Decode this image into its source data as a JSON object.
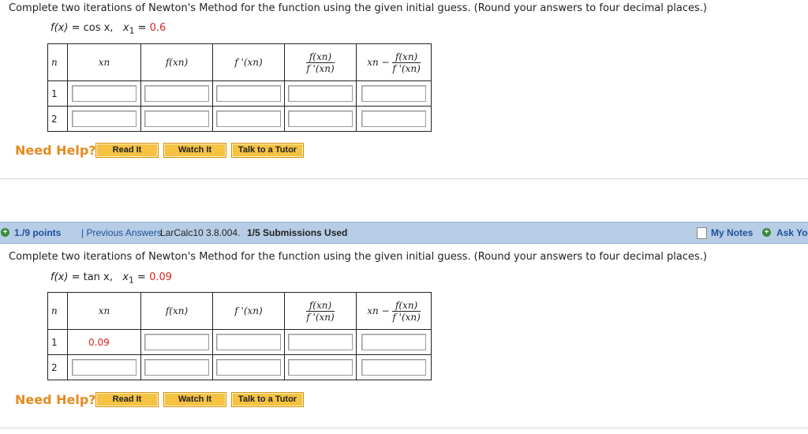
{
  "q1": {
    "instruction": "Complete two iterations of Newton's Method for the function using the given initial guess. (Round your answers to four decimal places.)",
    "f_label": "f(x)",
    "equals": "=",
    "func": "cos x,",
    "x1_label": "x",
    "x1_sub": "1",
    "x1_value": "0.6",
    "rows": [
      {
        "n": "1",
        "given": ""
      },
      {
        "n": "2",
        "given": ""
      }
    ]
  },
  "q2": {
    "instruction": "Complete two iterations of Newton's Method for the function using the given initial guess. (Round your answers to four decimal places.)",
    "f_label": "f(x)",
    "equals": "=",
    "func": "tan x,",
    "x1_label": "x",
    "x1_sub": "1",
    "x1_value": "0.09",
    "rows": [
      {
        "n": "1",
        "given": "0.09"
      },
      {
        "n": "2",
        "given": ""
      }
    ]
  },
  "table_headers": {
    "n": "n",
    "xn": "xn",
    "fxn": "f(xn)",
    "fpxn": "f '(xn)",
    "ratio_num": "f(xn)",
    "ratio_den": "f '(xn)",
    "update_prefix": "xn −",
    "update_num": "f(xn)",
    "update_den": "f '(xn)"
  },
  "help": {
    "label": "Need Help?",
    "read": "Read It",
    "watch": "Watch It",
    "talk": "Talk to a Tutor"
  },
  "bar": {
    "points": "1./9 points",
    "previous": "| Previous Answers",
    "source": "LarCalc10 3.8.004.",
    "submissions": "1/5 Submissions Used",
    "notes": "My Notes",
    "ask": "Ask Yo"
  },
  "colors": {
    "accent_orange": "#e68a1e",
    "bar_blue": "#b7cde6",
    "link_blue": "#1f4f9b",
    "given_red": "#dd2222"
  }
}
